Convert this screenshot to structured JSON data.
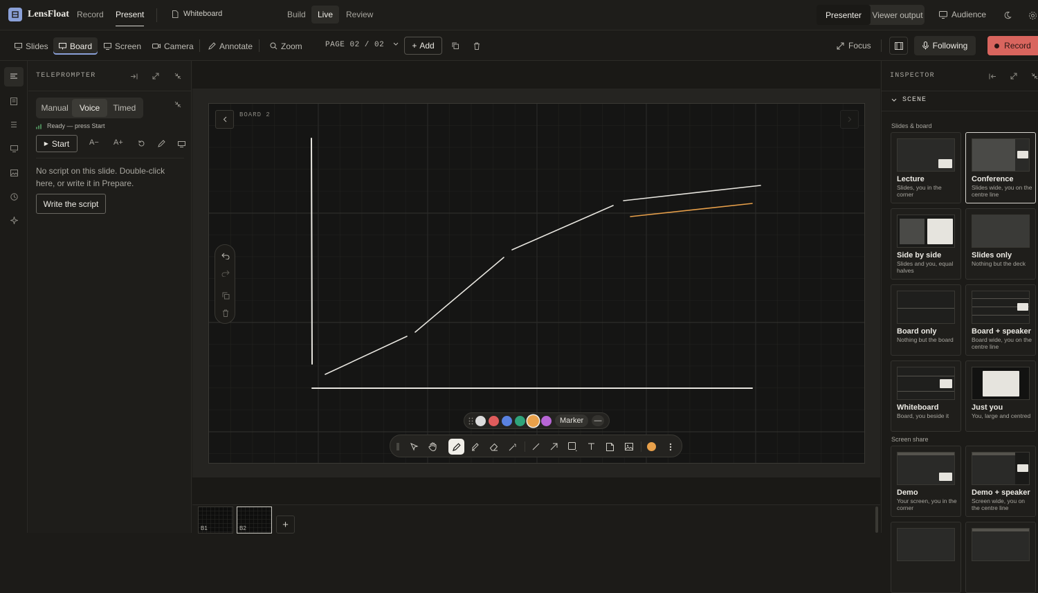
{
  "app": {
    "name": "LensFloat"
  },
  "topnav": {
    "record": "Record",
    "present": "Present",
    "document": "Whiteboard"
  },
  "modes": {
    "build": "Build",
    "live": "Live",
    "review": "Review"
  },
  "output": {
    "presenter": "Presenter",
    "viewer": "Viewer output",
    "audience": "Audience"
  },
  "toolbar": {
    "slides": "Slides",
    "board": "Board",
    "screen": "Screen",
    "camera": "Camera",
    "annotate": "Annotate",
    "zoom": "Zoom",
    "page": "PAGE 02 / 02",
    "add": "Add",
    "focus": "Focus",
    "following": "Following",
    "record": "Record"
  },
  "teleprompter": {
    "title": "TELEPROMPTER",
    "tabs": [
      "Manual",
      "Voice",
      "Timed"
    ],
    "status": "Ready — press Start",
    "start": "Start",
    "font_down": "A−",
    "font_up": "A+",
    "empty": "No script on this slide. Double-click here, or write it in Prepare.",
    "write": "Write the script"
  },
  "board": {
    "label": "BOARD 2",
    "marker_label": "Marker",
    "minus": "—",
    "colors": [
      "#dcdcdc",
      "#e05c5c",
      "#5a82e0",
      "#2fa37a",
      "#e8a04a",
      "#b866d6"
    ],
    "thumbs": [
      "B1",
      "B2"
    ],
    "add_thumb": "+"
  },
  "inspector": {
    "title": "INSPECTOR",
    "section": "SCENE",
    "group1": "Slides & board",
    "group2": "Screen share",
    "layouts": [
      {
        "title": "Lecture",
        "desc": "Slides, you in the corner"
      },
      {
        "title": "Conference",
        "desc": "Slides wide, you on the centre line"
      },
      {
        "title": "Side by side",
        "desc": "Slides and you, equal halves"
      },
      {
        "title": "Slides only",
        "desc": "Nothing but the deck"
      },
      {
        "title": "Board only",
        "desc": "Nothing but the board"
      },
      {
        "title": "Board + speaker",
        "desc": "Board wide, you on the centre line"
      },
      {
        "title": "Whiteboard",
        "desc": "Board, you beside it"
      },
      {
        "title": "Just you",
        "desc": "You, large and centred"
      },
      {
        "title": "Demo",
        "desc": "Your screen, you in the corner"
      },
      {
        "title": "Demo + speaker",
        "desc": "Screen wide, you on the centre line"
      }
    ]
  }
}
